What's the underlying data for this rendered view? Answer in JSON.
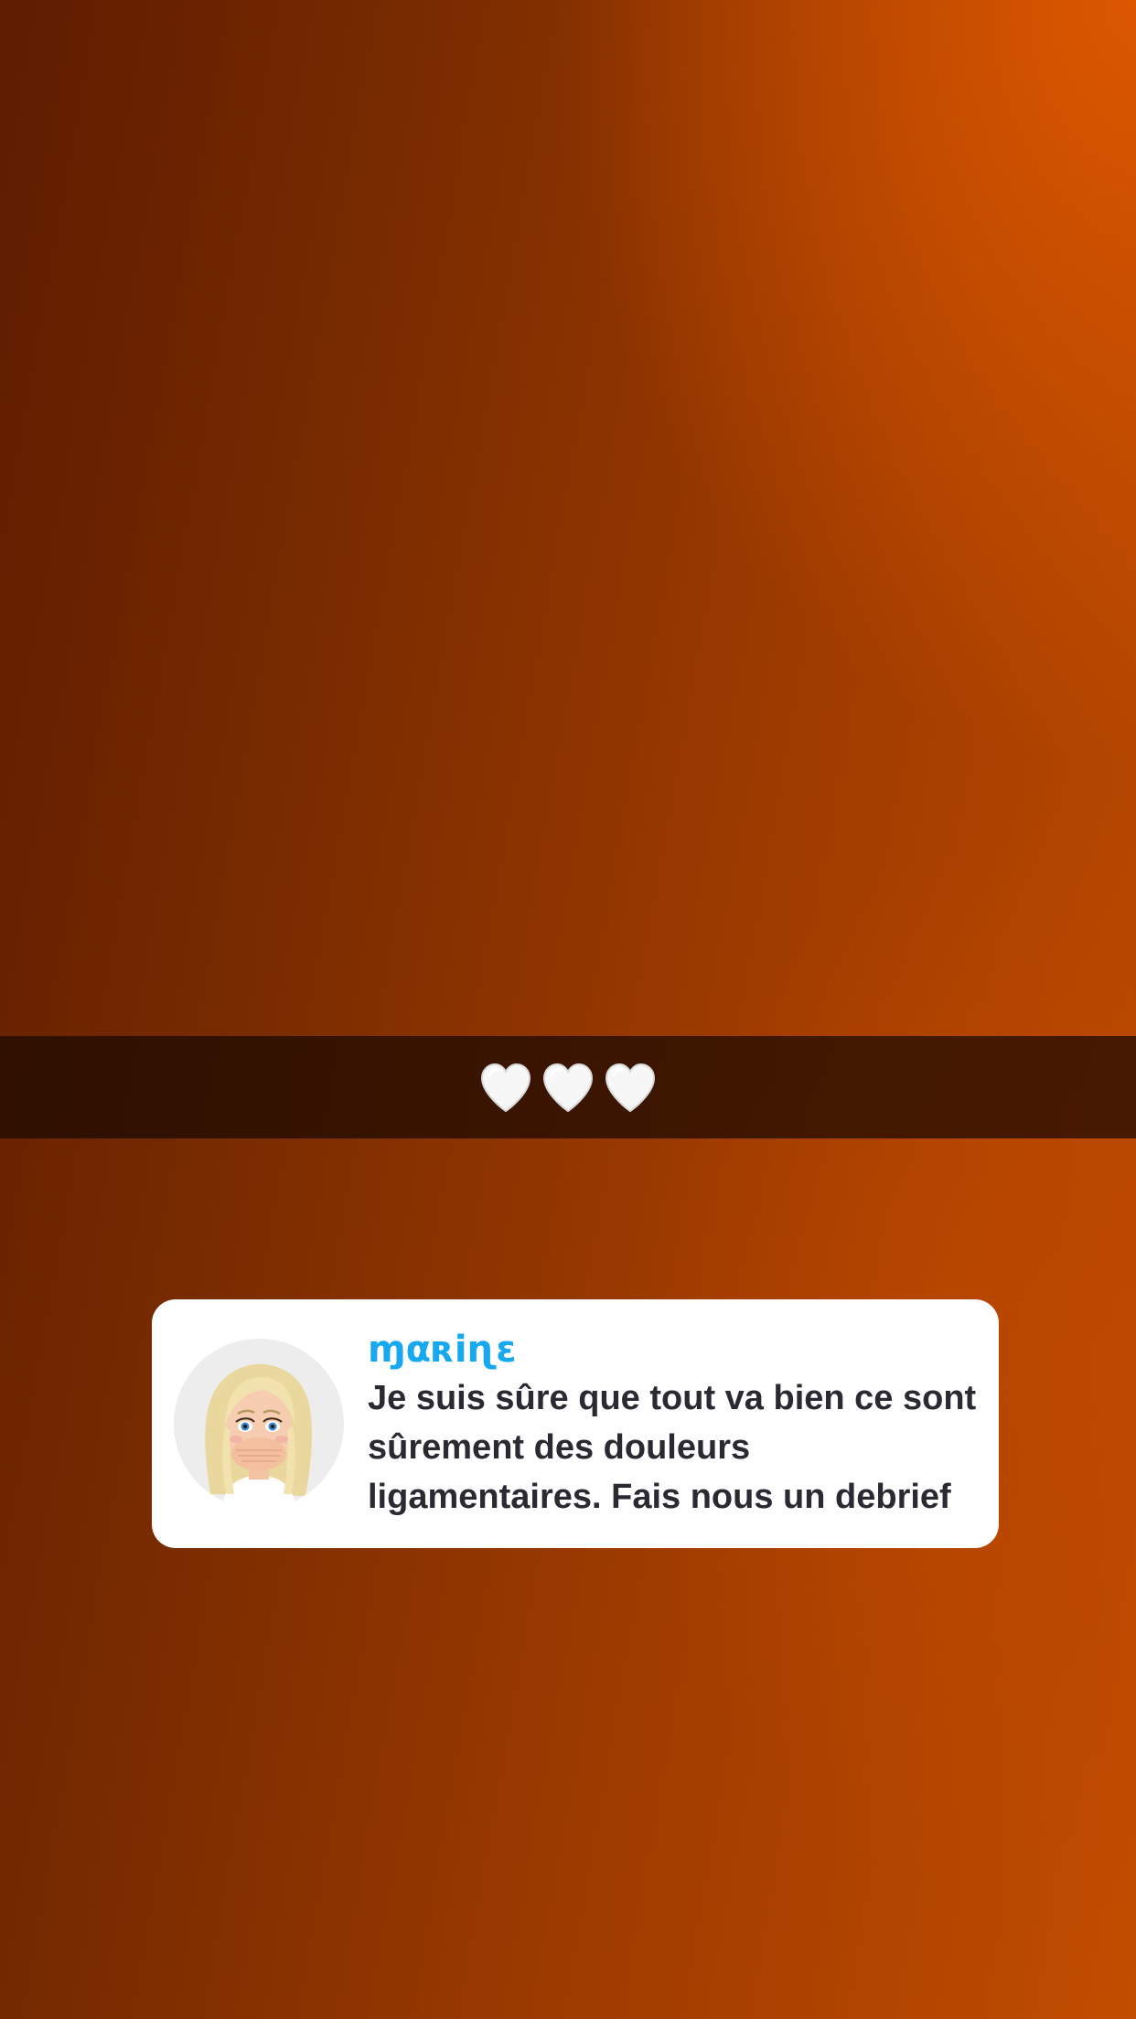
{
  "caption": {
    "hearts": [
      "white-heart",
      "white-heart",
      "white-heart"
    ],
    "heart_color": "#ffffff"
  },
  "comment": {
    "username": "ɱαʀiɳɛ",
    "message": "Je suis sûre que tout va bien ce sont sûrement des douleurs ligamentaires. Fais nous un debrief",
    "username_color": "#17a8f0",
    "avatar": "bitmoji-avatar"
  },
  "colors": {
    "background_start": "#5e1c00",
    "background_end": "#d85800",
    "caption_bar": "#190800"
  }
}
